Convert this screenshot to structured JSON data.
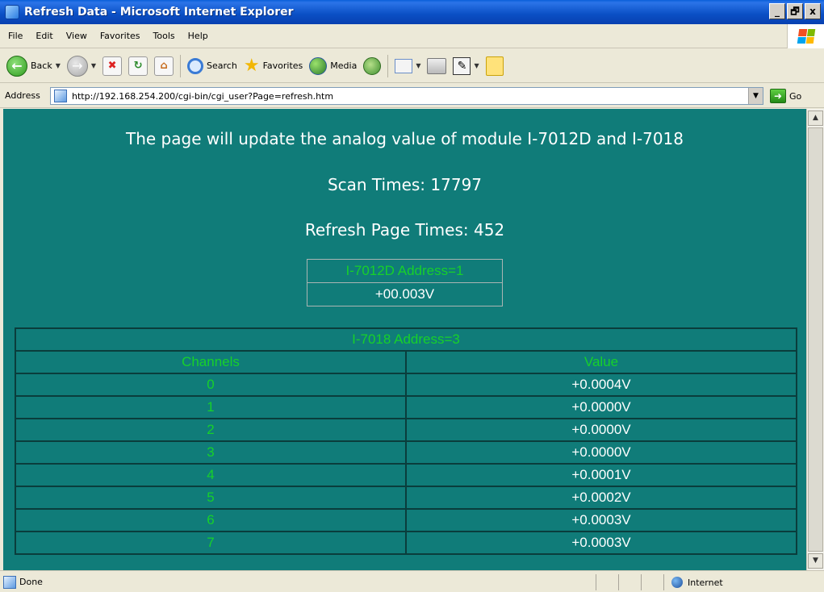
{
  "window": {
    "title": "Refresh Data - Microsoft Internet Explorer",
    "buttons": [
      "_",
      "🗗",
      "x"
    ]
  },
  "menu": {
    "items": [
      "File",
      "Edit",
      "View",
      "Favorites",
      "Tools",
      "Help"
    ]
  },
  "toolbar": {
    "back": "Back",
    "search": "Search",
    "favorites": "Favorites",
    "media": "Media"
  },
  "address": {
    "label": "Address",
    "url": "http://192.168.254.200/cgi-bin/cgi_user?Page=refresh.htm",
    "go": "Go"
  },
  "page": {
    "heading": "The page will update the analog value of module I-7012D and I-7018",
    "scan_times": "Scan Times: 17797",
    "refresh_times": "Refresh Page Times: 452",
    "module1": {
      "title": "I-7012D Address=1",
      "value": "+00.003V"
    },
    "module2": {
      "title": "I-7018 Address=3",
      "col_channels": "Channels",
      "col_value": "Value",
      "rows": [
        {
          "channel": "0",
          "value": "+0.0004V"
        },
        {
          "channel": "1",
          "value": "+0.0000V"
        },
        {
          "channel": "2",
          "value": "+0.0000V"
        },
        {
          "channel": "3",
          "value": "+0.0000V"
        },
        {
          "channel": "4",
          "value": "+0.0001V"
        },
        {
          "channel": "5",
          "value": "+0.0002V"
        },
        {
          "channel": "6",
          "value": "+0.0003V"
        },
        {
          "channel": "7",
          "value": "+0.0003V"
        }
      ]
    }
  },
  "status": {
    "text": "Done",
    "zone": "Internet"
  },
  "colors": {
    "page_bg": "#107c79",
    "green_text": "#17d12a",
    "white_text": "#ffffff"
  }
}
